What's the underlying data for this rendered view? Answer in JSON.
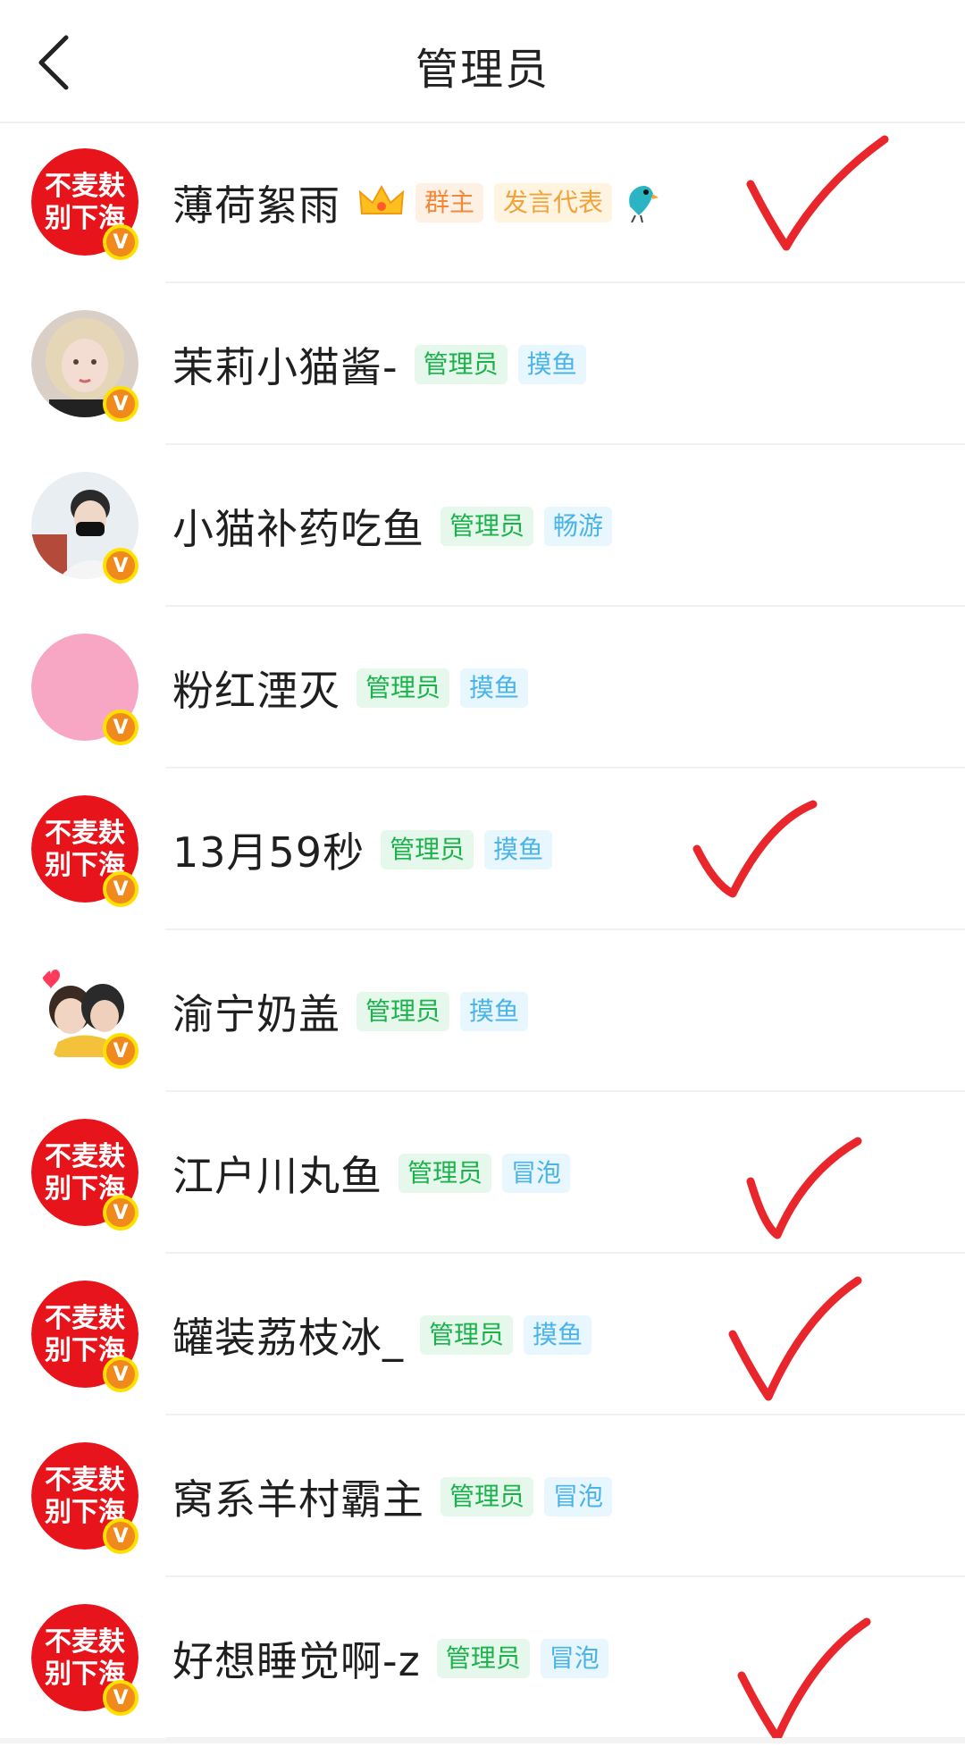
{
  "header": {
    "title": "管理员"
  },
  "avatar_text": {
    "line1": "不麦麸",
    "line2": "别下海"
  },
  "badge_letter": "V",
  "members": [
    {
      "name": "薄荷絮雨",
      "avatar": "red-text",
      "tags": [
        {
          "label": "群主",
          "kind": "owner"
        },
        {
          "label": "发言代表",
          "kind": "rep"
        }
      ],
      "crown": true,
      "bird": true,
      "checked": true
    },
    {
      "name": "茉莉小猫酱-",
      "avatar": "photo-girl",
      "tags": [
        {
          "label": "管理员",
          "kind": "admin"
        },
        {
          "label": "摸鱼",
          "kind": "grade"
        }
      ],
      "checked": false
    },
    {
      "name": "小猫补药吃鱼",
      "avatar": "photo-boy",
      "tags": [
        {
          "label": "管理员",
          "kind": "admin"
        },
        {
          "label": "畅游",
          "kind": "grade"
        }
      ],
      "checked": false
    },
    {
      "name": "粉红湮灭",
      "avatar": "pink",
      "tags": [
        {
          "label": "管理员",
          "kind": "admin"
        },
        {
          "label": "摸鱼",
          "kind": "grade"
        }
      ],
      "checked": false
    },
    {
      "name": "13月59秒",
      "avatar": "red-text",
      "tags": [
        {
          "label": "管理员",
          "kind": "admin"
        },
        {
          "label": "摸鱼",
          "kind": "grade"
        }
      ],
      "checked": true
    },
    {
      "name": "渝宁奶盖",
      "avatar": "photo-couple",
      "tags": [
        {
          "label": "管理员",
          "kind": "admin"
        },
        {
          "label": "摸鱼",
          "kind": "grade"
        }
      ],
      "checked": false
    },
    {
      "name": "江户川丸鱼",
      "avatar": "red-text",
      "tags": [
        {
          "label": "管理员",
          "kind": "admin"
        },
        {
          "label": "冒泡",
          "kind": "grade"
        }
      ],
      "checked": true
    },
    {
      "name": "罐装荔枝冰_",
      "avatar": "red-text",
      "tags": [
        {
          "label": "管理员",
          "kind": "admin"
        },
        {
          "label": "摸鱼",
          "kind": "grade"
        }
      ],
      "checked": true
    },
    {
      "name": "窝系羊村霸主",
      "avatar": "red-text",
      "tags": [
        {
          "label": "管理员",
          "kind": "admin"
        },
        {
          "label": "冒泡",
          "kind": "grade"
        }
      ],
      "checked": false
    },
    {
      "name": "好想睡觉啊-z",
      "avatar": "red-text",
      "tags": [
        {
          "label": "管理员",
          "kind": "admin"
        },
        {
          "label": "冒泡",
          "kind": "grade"
        }
      ],
      "checked": true
    }
  ],
  "colors": {
    "admin_tag": "#19b24b",
    "grade_tag": "#4ab3e8",
    "owner_tag": "#f2883a",
    "check_mark": "#e8262c",
    "avatar_red": "#e8141c"
  },
  "icons": [
    "back-arrow-icon",
    "crown-icon",
    "bird-icon",
    "verified-badge-icon",
    "check-mark-icon"
  ]
}
